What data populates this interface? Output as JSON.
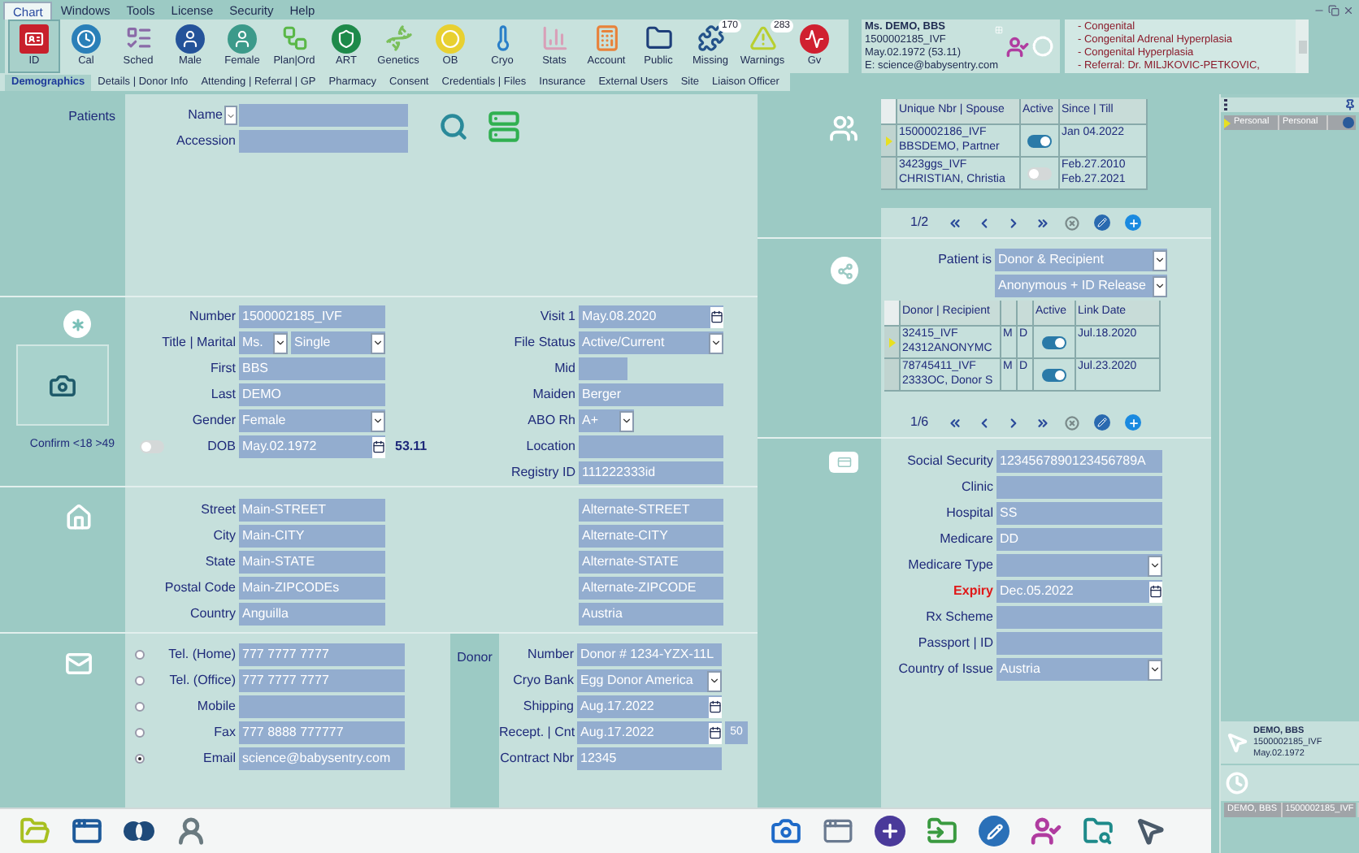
{
  "menu": [
    {
      "label": "Chart",
      "selected": true
    },
    {
      "label": "Windows",
      "selected": false
    },
    {
      "label": "Tools",
      "selected": false
    },
    {
      "label": "License",
      "selected": false
    },
    {
      "label": "Security",
      "selected": false
    },
    {
      "label": "Help",
      "selected": false
    }
  ],
  "toolbar": [
    {
      "label": "ID",
      "selected": true
    },
    {
      "label": "Cal",
      "selected": false
    },
    {
      "label": "Sched",
      "selected": false
    },
    {
      "label": "Male",
      "selected": false
    },
    {
      "label": "Female",
      "selected": false
    },
    {
      "label": "Plan|Ord",
      "selected": false
    },
    {
      "label": "ART",
      "selected": false
    },
    {
      "label": "Genetics",
      "selected": false
    },
    {
      "label": "OB",
      "selected": false
    },
    {
      "label": "Cryo",
      "selected": false
    },
    {
      "label": "Stats",
      "selected": false
    },
    {
      "label": "Account",
      "selected": false
    },
    {
      "label": "Public",
      "selected": false
    },
    {
      "label": "Missing",
      "selected": false,
      "badge": "170"
    },
    {
      "label": "Warnings",
      "selected": false,
      "badge": "283"
    },
    {
      "label": "Gv",
      "selected": false
    }
  ],
  "patient_card": {
    "name": "Ms. DEMO, BBS",
    "number": "1500002185_IVF",
    "dob": "May.02.1972 (53.11)",
    "email": "E: science@babysentry.com"
  },
  "alerts": [
    "- Congenital",
    "- Congenital Adrenal Hyperplasia",
    "- Congenital Hyperplasia",
    "- Referral: Dr. MILJKOVIC-PETKOVIC,"
  ],
  "tabs": [
    {
      "label": "Demographics",
      "selected": true
    },
    {
      "label": "Details | Donor Info",
      "selected": false
    },
    {
      "label": "Attending | Referral | GP",
      "selected": false
    },
    {
      "label": "Pharmacy",
      "selected": false
    },
    {
      "label": "Consent",
      "selected": false
    },
    {
      "label": "Credentials | Files",
      "selected": false
    },
    {
      "label": "Insurance",
      "selected": false
    },
    {
      "label": "External Users",
      "selected": false
    },
    {
      "label": "Site",
      "selected": false
    },
    {
      "label": "Liaison Officer",
      "selected": false
    }
  ],
  "patients": {
    "title": "Patients",
    "name_label": "Name",
    "accession_label": "Accession"
  },
  "identity": {
    "confirm_label": "Confirm <18 >49",
    "confirm_on": false,
    "age": "53.11",
    "left": [
      {
        "label": "Number",
        "kind": "text",
        "value": "1500002185_IVF"
      },
      {
        "label": "Title | Marital",
        "kind": "pair",
        "values": [
          "Ms.",
          "Single"
        ]
      },
      {
        "label": "First",
        "kind": "text",
        "value": "BBS"
      },
      {
        "label": "Last",
        "kind": "text",
        "value": "DEMO"
      },
      {
        "label": "Gender",
        "kind": "select",
        "value": "Female"
      },
      {
        "label": "DOB",
        "kind": "date",
        "value": "May.02.1972"
      }
    ],
    "right": [
      {
        "label": "Visit 1",
        "kind": "date",
        "value": "May.08.2020"
      },
      {
        "label": "File Status",
        "kind": "select",
        "value": "Active/Current"
      },
      {
        "label": "Mid",
        "kind": "short-text"
      },
      {
        "label": "Maiden",
        "kind": "text",
        "value": "Berger"
      },
      {
        "label": "ABO Rh",
        "kind": "short-select",
        "value": "A+"
      },
      {
        "label": "Location",
        "kind": "text"
      },
      {
        "label": "Registry ID",
        "kind": "text",
        "value": "111222333id"
      }
    ]
  },
  "address": [
    {
      "label": "Street",
      "main": "Main-STREET",
      "alternate": "Alternate-STREET"
    },
    {
      "label": "City",
      "main": "Main-CITY",
      "alternate": "Alternate-CITY"
    },
    {
      "label": "State",
      "main": "Main-STATE",
      "alternate": "Alternate-STATE"
    },
    {
      "label": "Postal Code",
      "main": "Main-ZIPCODEs",
      "alternate": "Alternate-ZIPCODE"
    },
    {
      "label": "Country",
      "main": "Anguilla",
      "alternate": "Austria"
    }
  ],
  "contact": [
    {
      "label": "Tel. (Home)",
      "value": "777 7777 7777",
      "selected": false
    },
    {
      "label": "Tel. (Office)",
      "value": "777 7777 7777",
      "selected": false
    },
    {
      "label": "Mobile",
      "selected": false
    },
    {
      "label": "Fax",
      "value": "777 8888 777777",
      "selected": false
    },
    {
      "label": "Email",
      "value": "science@babysentry.com",
      "selected": true
    }
  ],
  "donor": {
    "title": "Donor",
    "fields": [
      {
        "label": "Number",
        "kind": "text",
        "value": "Donor # 1234-YZX-11L"
      },
      {
        "label": "Cryo Bank",
        "kind": "select",
        "value": "Egg Donor America"
      },
      {
        "label": "Shipping",
        "kind": "date",
        "value": "Aug.17.2022"
      },
      {
        "label": "Recept. | Cnt",
        "kind": "date",
        "value": "Aug.17.2022",
        "count": "50"
      },
      {
        "label": "Contract Nbr",
        "kind": "text",
        "value": "12345"
      }
    ]
  },
  "spouses": {
    "columns": [
      "Unique Nbr | Spouse",
      "Active",
      "Since | Till"
    ],
    "rows": [
      {
        "lines": [
          "1500002186_IVF",
          "BBSDEMO, Partner"
        ],
        "active": true,
        "dates": [
          "Jan 04.2022"
        ],
        "selected": true
      },
      {
        "lines": [
          "3423ggs_IVF",
          "CHRISTIAN, Christia"
        ],
        "active": false,
        "dates": [
          "Feb.27.2010",
          "Feb.27.2021"
        ],
        "selected": false
      }
    ],
    "pager": "1/2"
  },
  "sharing": {
    "label": "Patient is",
    "selects": [
      "Donor & Recipient",
      "Anonymous + ID Release"
    ],
    "columns": [
      "Donor | Recipient",
      "Active",
      "Link Date"
    ],
    "rows": [
      {
        "lines": [
          "32415_IVF",
          "24312ANONYMC"
        ],
        "sex": "M",
        "role": "D",
        "active": true,
        "date": "Jul.18.2020",
        "selected": true
      },
      {
        "lines": [
          "78745411_IVF",
          "2333OC, Donor S"
        ],
        "sex": "M",
        "role": "D",
        "active": true,
        "date": "Jul.23.2020",
        "selected": false
      }
    ],
    "pager": "1/6"
  },
  "insurance": [
    {
      "label": "Social Security",
      "kind": "text",
      "value": "1234567890123456789A",
      "alert": false
    },
    {
      "label": "Clinic",
      "kind": "text",
      "alert": false
    },
    {
      "label": "Hospital",
      "kind": "text",
      "value": "SS",
      "alert": false
    },
    {
      "label": "Medicare",
      "kind": "text",
      "value": "DD",
      "alert": false
    },
    {
      "label": "Medicare Type",
      "kind": "select",
      "alert": false
    },
    {
      "label": "Expiry",
      "kind": "date",
      "value": "Dec.05.2022",
      "alert": true
    },
    {
      "label": "Rx Scheme",
      "kind": "text",
      "alert": false
    },
    {
      "label": "Passport | ID",
      "kind": "text",
      "alert": false
    },
    {
      "label": "Country of Issue",
      "kind": "select",
      "value": "Austria",
      "alert": false
    }
  ],
  "sidebar": {
    "rows": [
      {
        "columns": [
          "Personal",
          "Personal"
        ],
        "selected": true
      }
    ],
    "patient": {
      "name": "DEMO, BBS",
      "number": "1500002185_IVF",
      "dob": "May.02.1972"
    },
    "recent": [
      {
        "columns": [
          "DEMO, BBS",
          "1500002185_IVF"
        ],
        "selected": true
      }
    ]
  }
}
